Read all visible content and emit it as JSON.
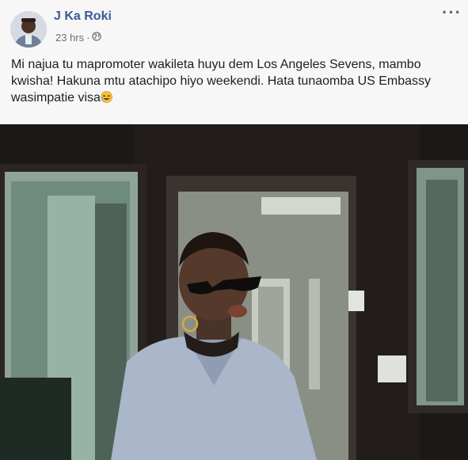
{
  "post": {
    "author": "J Ka Roki",
    "timestamp": "23 hrs",
    "separator": "·",
    "privacy_icon": "globe-icon",
    "more_icon": "more-options-icon",
    "more_glyph": "···",
    "text": "Mi najua tu mapromoter wakileta huyu dem Los Angeles Sevens, mambo kwisha! Hakuna mtu atachipo hiyo weekendi. Hata tunaomba US Embassy wasimpatie visa",
    "emoji_icon": "laughing-emoji-icon"
  },
  "colors": {
    "author_name": "#3b5998",
    "meta_text": "#6b7079",
    "header_bg": "#f7f7f8",
    "video_bg": "#1a1715"
  }
}
